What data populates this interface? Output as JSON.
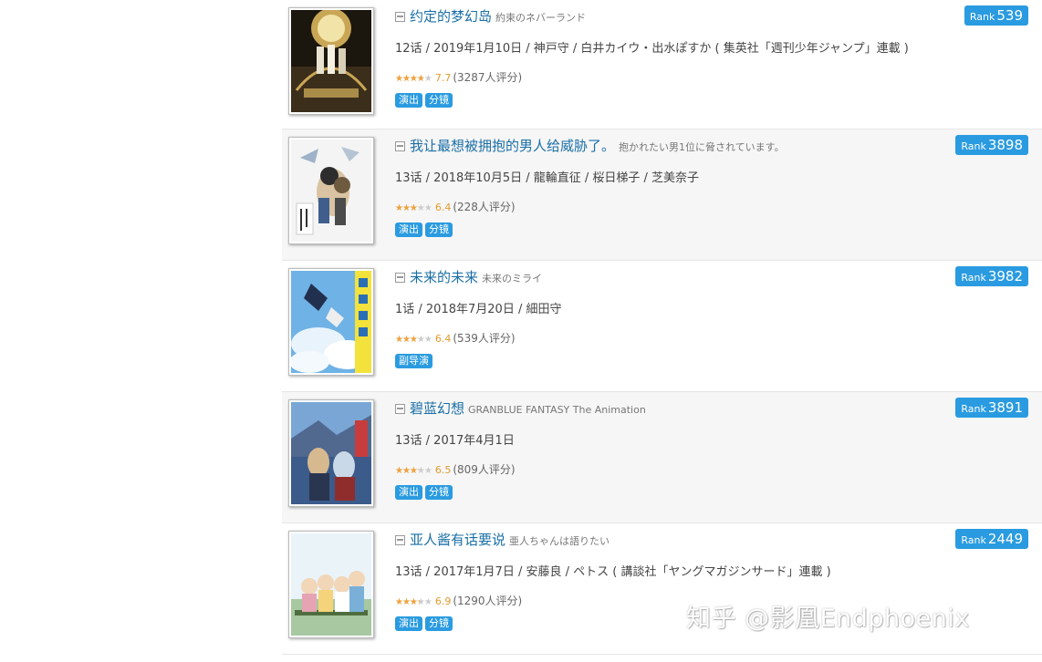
{
  "entries": [
    {
      "title": "约定的梦幻岛",
      "subtitle": "約束のネバーランド",
      "info": "12话 / 2019年1月10日 / 神戸守 / 白井カイウ・出水ぽすか ( 集英社「週刊少年ジャンプ」連載 )",
      "rating": 7.7,
      "score": "7.7",
      "votes": "(3287人评分)",
      "tags": [
        "演出",
        "分镜"
      ],
      "rank_label": "Rank",
      "rank": "539"
    },
    {
      "title": "我让最想被拥抱的男人给威胁了。",
      "subtitle": "抱かれたい男1位に脅されています。",
      "info": "13话 / 2018年10月5日 / 龍輪直征 / 桜日梯子 / 芝美奈子",
      "rating": 6.4,
      "score": "6.4",
      "votes": "(228人评分)",
      "tags": [
        "演出",
        "分镜"
      ],
      "rank_label": "Rank",
      "rank": "3898"
    },
    {
      "title": "未来的未来",
      "subtitle": "未来のミライ",
      "info": "1话 / 2018年7月20日 / 細田守",
      "rating": 6.4,
      "score": "6.4",
      "votes": "(539人评分)",
      "tags": [
        "副导演"
      ],
      "rank_label": "Rank",
      "rank": "3982"
    },
    {
      "title": "碧蓝幻想",
      "subtitle": "GRANBLUE FANTASY The Animation",
      "info": "13话 / 2017年4月1日",
      "rating": 6.5,
      "score": "6.5",
      "votes": "(809人评分)",
      "tags": [
        "演出",
        "分镜"
      ],
      "rank_label": "Rank",
      "rank": "3891"
    },
    {
      "title": "亚人酱有话要说",
      "subtitle": "亜人ちゃんは語りたい",
      "info": "13话 / 2017年1月7日 / 安藤良 / ペトス ( 講談社「ヤングマガジンサード」連載 )",
      "rating": 6.9,
      "score": "6.9",
      "votes": "(1290人评分)",
      "tags": [
        "演出",
        "分镜"
      ],
      "rank_label": "Rank",
      "rank": "2449"
    }
  ],
  "watermark": "知乎 @影凰Endphoenix",
  "colors": {
    "link": "#1a6fa6",
    "tag_bg": "#2a9be0",
    "star": "#f0a23c",
    "alt_row": "#f6f6f6"
  },
  "icons": {
    "title_prefix": "book-icon",
    "star": "star-icon"
  }
}
